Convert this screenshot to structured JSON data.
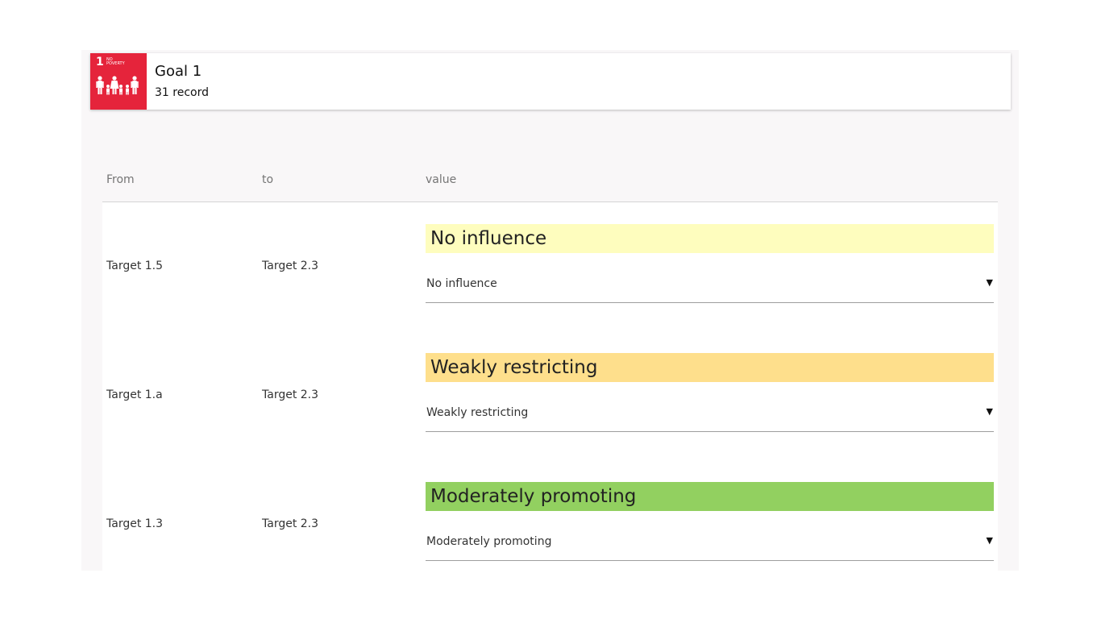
{
  "goal": {
    "icon": {
      "number": "1",
      "caption": "NO POVERTY",
      "color": "#e5243b"
    },
    "title": "Goal 1",
    "record_count": "31 record"
  },
  "table": {
    "headers": {
      "from": "From",
      "to": "to",
      "value": "value"
    },
    "rows": [
      {
        "from": "Target 1.5",
        "to": "Target 2.3",
        "value_label": "No influence",
        "value_color": "#fefdbe",
        "selected": "No influence"
      },
      {
        "from": "Target 1.a",
        "to": "Target 2.3",
        "value_label": "Weakly restricting",
        "value_color": "#fedf8c",
        "selected": "Weakly restricting"
      },
      {
        "from": "Target 1.3",
        "to": "Target 2.3",
        "value_label": "Moderately promoting",
        "value_color": "#92d060",
        "selected": "Moderately promoting"
      }
    ]
  },
  "icons": {
    "dropdown": "caret-down-icon",
    "goal": "family-icon"
  }
}
